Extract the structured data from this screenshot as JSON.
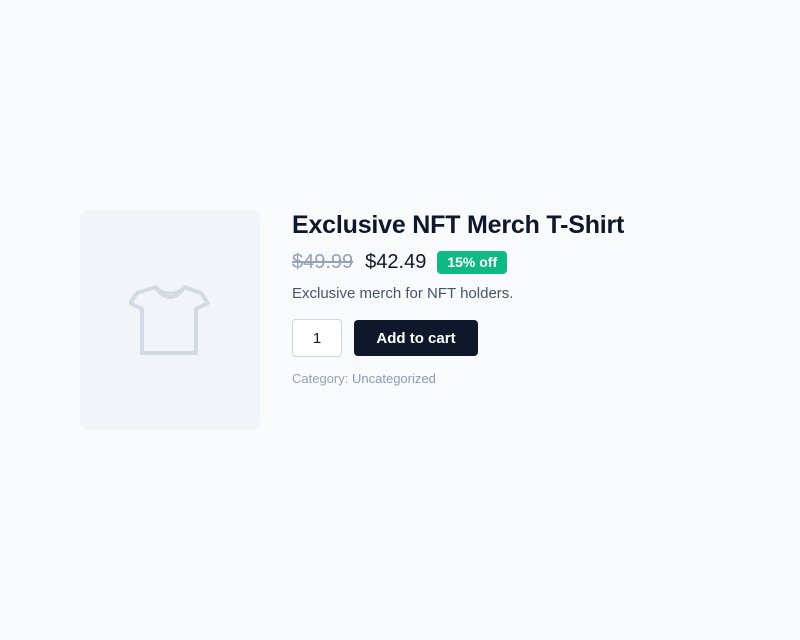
{
  "product": {
    "title": "Exclusive NFT Merch T-Shirt",
    "original_price": "$49.99",
    "sale_price": "$42.49",
    "discount_badge": "15% off",
    "description": "Exclusive merch for NFT holders.",
    "quantity": "1",
    "add_to_cart_label": "Add to cart",
    "category_label": "Category:",
    "category_value": "Uncategorized",
    "image_icon": "t-shirt-icon"
  },
  "colors": {
    "background": "#f8fafc",
    "image_placeholder": "#f1f5f9",
    "badge": "#10b981",
    "button": "#0f172a"
  }
}
